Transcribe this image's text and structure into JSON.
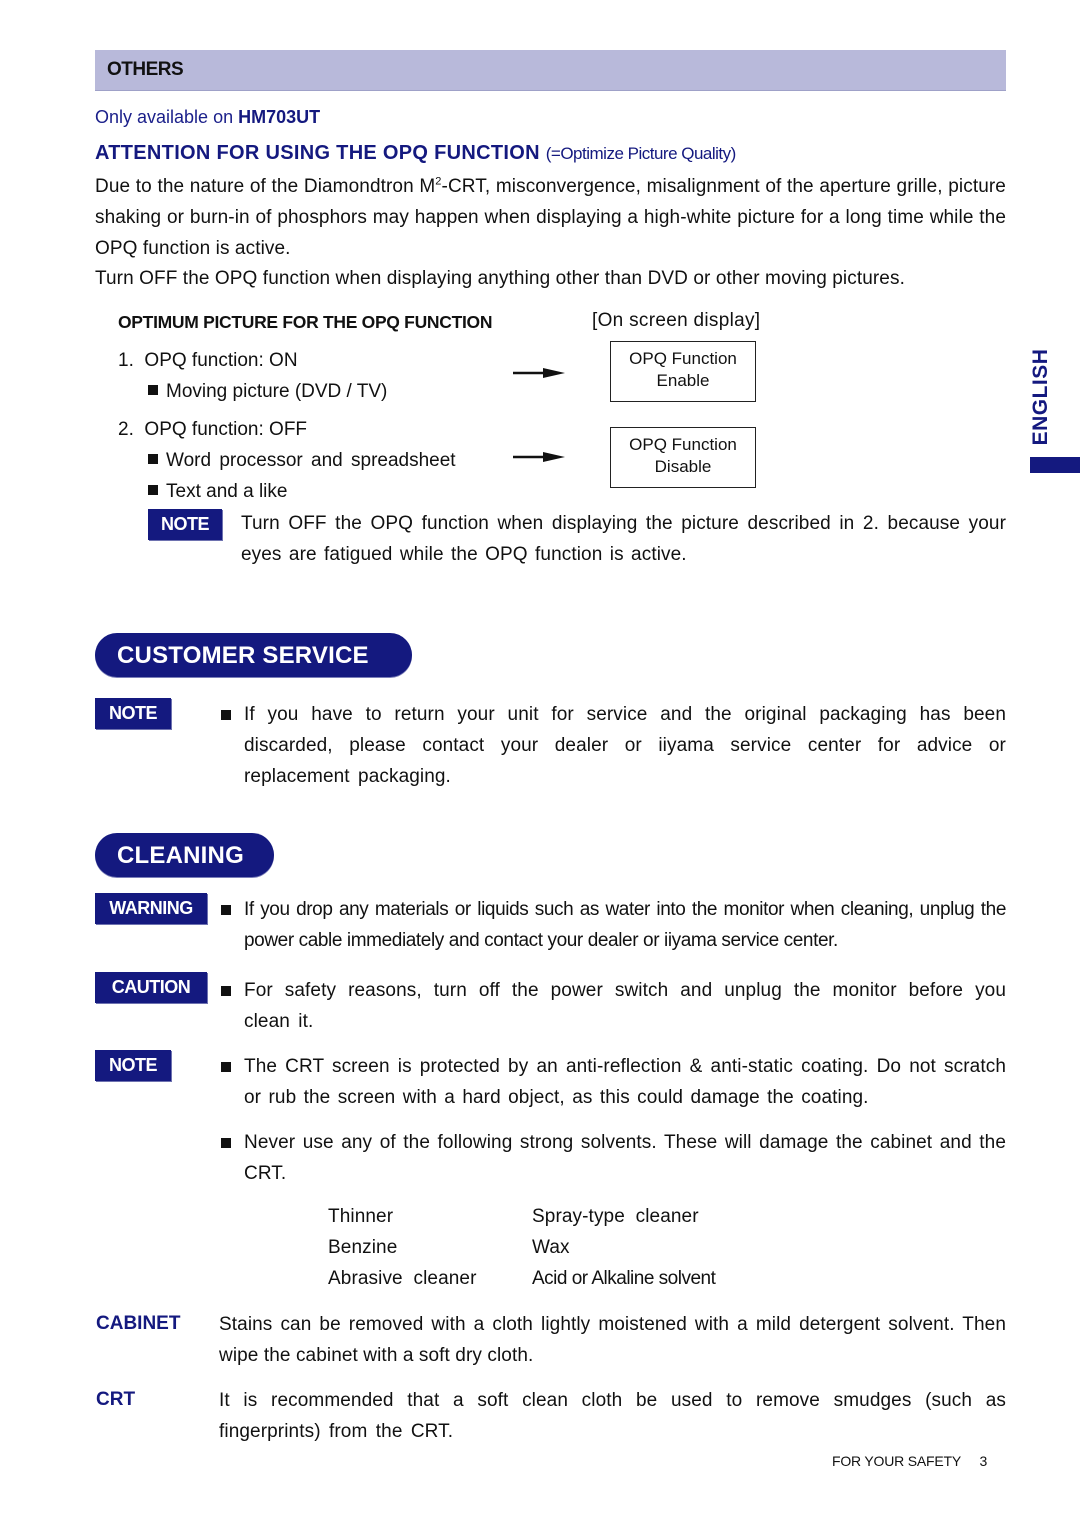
{
  "others": {
    "header": "OTHERS",
    "availability_prefix": "Only available on ",
    "availability_model": "HM703UT",
    "attention_title": "ATTENTION FOR USING THE OPQ FUNCTION",
    "attention_subtitle": "(=Optimize Picture Quality)",
    "para1_before_sup": "Due to the nature of the Diamondtron M",
    "para1_sup": "2",
    "para1_after_sup": "-CRT, misconvergence, misalignment of the aperture grille, picture shaking or burn-in of phosphors may happen when displaying a high-white picture for a long time while the OPQ function is active.",
    "para2": "Turn OFF the OPQ function when displaying anything other than DVD or other moving pictures.",
    "optimum_title": "OPTIMUM PICTURE FOR THE OPQ FUNCTION",
    "osd_label": "[On screen display]",
    "items": [
      {
        "number": "1.",
        "label": "OPQ function: ON",
        "bullets": [
          "Moving picture (DVD / TV)"
        ],
        "osd_line1": "OPQ Function",
        "osd_line2": "Enable"
      },
      {
        "number": "2.",
        "label": "OPQ function: OFF",
        "bullets": [
          "Word processor and spreadsheet",
          "Text and a like"
        ],
        "osd_line1": "OPQ Function",
        "osd_line2": "Disable"
      }
    ],
    "note_badge": "NOTE",
    "note_text": "Turn OFF the OPQ function when displaying the picture described in 2. because your eyes are fatigued while the OPQ function is active."
  },
  "language_tab": "ENGLISH",
  "customer_service": {
    "title": "CUSTOMER SERVICE",
    "note_badge": "NOTE",
    "text": "If you have to return your unit for service and the original packaging has been discarded, please contact your dealer or iiyama service center for advice or replacement packaging."
  },
  "cleaning": {
    "title": "CLEANING",
    "warning_badge": "WARNING",
    "warning_text": "If you drop any materials or liquids such as water into the monitor when cleaning, unplug the power cable immediately and contact your dealer or iiyama service center.",
    "caution_badge": "CAUTION",
    "caution_text": "For safety reasons, turn off the power switch and unplug the monitor before you clean it.",
    "note_badge": "NOTE",
    "note_text1": "The CRT screen is protected by an anti-reflection & anti-static coating. Do not scratch or rub the screen with a hard object, as this could damage the coating.",
    "note_text2": "Never use any of the following strong solvents. These will damage the cabinet and the CRT.",
    "solvents": [
      [
        "Thinner",
        "Spray-type  cleaner"
      ],
      [
        "Benzine",
        "Wax"
      ],
      [
        "Abrasive  cleaner",
        "Acid or Alkaline solvent"
      ]
    ],
    "cabinet_label": "CABINET",
    "cabinet_text": "Stains can be removed with a cloth lightly moistened with a mild detergent solvent. Then wipe the cabinet with a soft dry cloth.",
    "crt_label": "CRT",
    "crt_text": "It is recommended that a soft clean cloth be used to remove smudges (such as fingerprints) from the CRT."
  },
  "footer": {
    "section": "FOR YOUR SAFETY",
    "page": "3"
  },
  "colors": {
    "brand_navy": "#14197f",
    "header_bar": "#b8b9da"
  }
}
